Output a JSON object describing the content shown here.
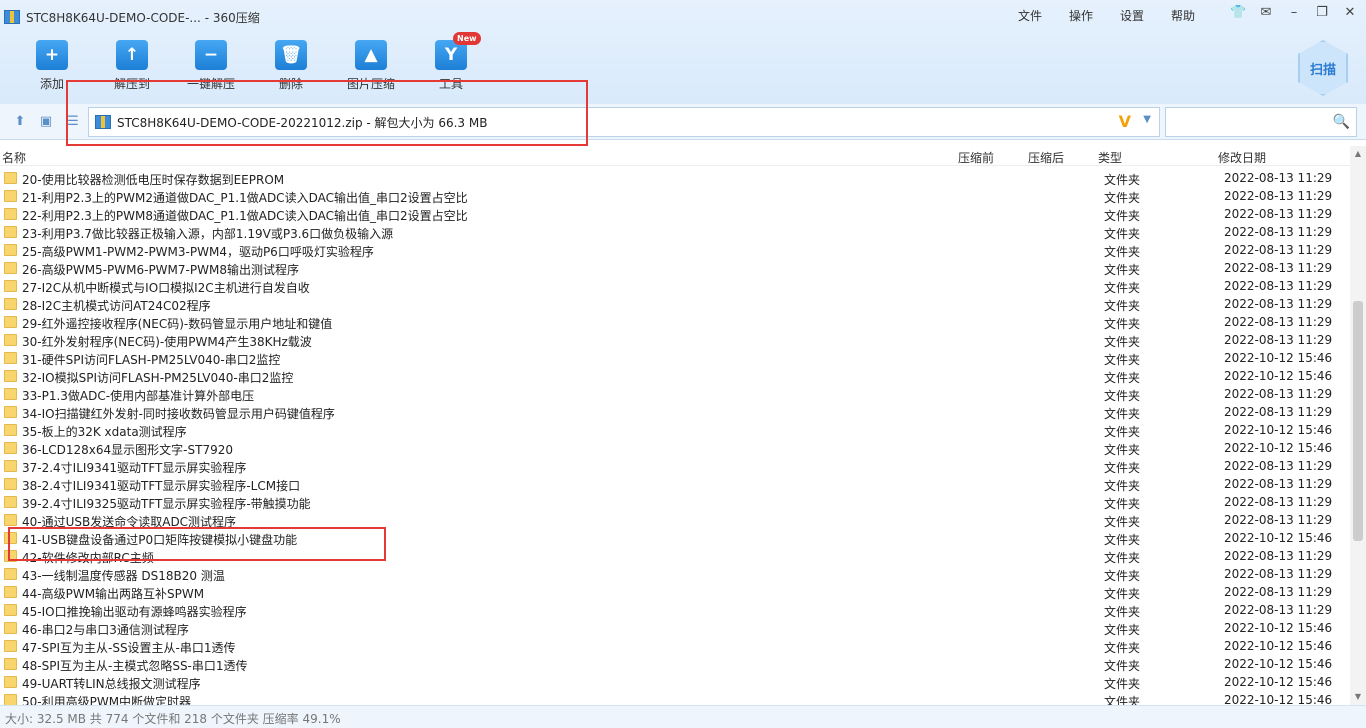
{
  "window": {
    "title": "STC8H8K64U-DEMO-CODE-... - 360压缩",
    "menu": [
      "文件",
      "操作",
      "设置",
      "帮助"
    ]
  },
  "toolbar": {
    "buttons": [
      {
        "label": "添加",
        "icon": "add-icon"
      },
      {
        "label": "解压到",
        "icon": "extract-to-icon"
      },
      {
        "label": "一键解压",
        "icon": "one-click-extract-icon"
      },
      {
        "label": "删除",
        "icon": "delete-icon"
      },
      {
        "label": "图片压缩",
        "icon": "image-compress-icon"
      },
      {
        "label": "工具",
        "icon": "tools-icon",
        "badge": "New"
      }
    ],
    "scan_label": "扫描"
  },
  "address": {
    "path": "STC8H8K64U-DEMO-CODE-20221012.zip - 解包大小为 66.3 MB"
  },
  "columns": {
    "name": "名称",
    "before": "压缩前",
    "after": "压缩后",
    "type": "类型",
    "modified": "修改日期"
  },
  "files": [
    {
      "name": "20-使用比较器检测低电压时保存数据到EEPROM",
      "type": "文件夹",
      "date": "2022-08-13 11:29"
    },
    {
      "name": "21-利用P2.3上的PWM2通道做DAC_P1.1做ADC读入DAC输出值_串口2设置占空比",
      "type": "文件夹",
      "date": "2022-08-13 11:29"
    },
    {
      "name": "22-利用P2.3上的PWM8通道做DAC_P1.1做ADC读入DAC输出值_串口2设置占空比",
      "type": "文件夹",
      "date": "2022-08-13 11:29"
    },
    {
      "name": "23-利用P3.7做比较器正极输入源，内部1.19V或P3.6口做负极输入源",
      "type": "文件夹",
      "date": "2022-08-13 11:29"
    },
    {
      "name": "25-高级PWM1-PWM2-PWM3-PWM4，驱动P6口呼吸灯实验程序",
      "type": "文件夹",
      "date": "2022-08-13 11:29"
    },
    {
      "name": "26-高级PWM5-PWM6-PWM7-PWM8输出测试程序",
      "type": "文件夹",
      "date": "2022-08-13 11:29"
    },
    {
      "name": "27-I2C从机中断模式与IO口模拟I2C主机进行自发自收",
      "type": "文件夹",
      "date": "2022-08-13 11:29"
    },
    {
      "name": "28-I2C主机模式访问AT24C02程序",
      "type": "文件夹",
      "date": "2022-08-13 11:29"
    },
    {
      "name": "29-红外遥控接收程序(NEC码)-数码管显示用户地址和键值",
      "type": "文件夹",
      "date": "2022-08-13 11:29"
    },
    {
      "name": "30-红外发射程序(NEC码)-使用PWM4产生38KHz载波",
      "type": "文件夹",
      "date": "2022-08-13 11:29"
    },
    {
      "name": "31-硬件SPI访问FLASH-PM25LV040-串口2监控",
      "type": "文件夹",
      "date": "2022-10-12 15:46"
    },
    {
      "name": "32-IO模拟SPI访问FLASH-PM25LV040-串口2监控",
      "type": "文件夹",
      "date": "2022-10-12 15:46"
    },
    {
      "name": "33-P1.3做ADC-使用内部基准计算外部电压",
      "type": "文件夹",
      "date": "2022-08-13 11:29"
    },
    {
      "name": "34-IO扫描键红外发射-同时接收数码管显示用户码键值程序",
      "type": "文件夹",
      "date": "2022-08-13 11:29"
    },
    {
      "name": "35-板上的32K xdata测试程序",
      "type": "文件夹",
      "date": "2022-10-12 15:46"
    },
    {
      "name": "36-LCD128x64显示图形文字-ST7920",
      "type": "文件夹",
      "date": "2022-10-12 15:46"
    },
    {
      "name": "37-2.4寸ILI9341驱动TFT显示屏实验程序",
      "type": "文件夹",
      "date": "2022-08-13 11:29"
    },
    {
      "name": "38-2.4寸ILI9341驱动TFT显示屏实验程序-LCM接口",
      "type": "文件夹",
      "date": "2022-08-13 11:29"
    },
    {
      "name": "39-2.4寸ILI9325驱动TFT显示屏实验程序-带触摸功能",
      "type": "文件夹",
      "date": "2022-08-13 11:29"
    },
    {
      "name": "40-通过USB发送命令读取ADC测试程序",
      "type": "文件夹",
      "date": "2022-08-13 11:29"
    },
    {
      "name": "41-USB键盘设备通过P0口矩阵按键模拟小键盘功能",
      "type": "文件夹",
      "date": "2022-10-12 15:46"
    },
    {
      "name": "42-软件修改内部RC主频",
      "type": "文件夹",
      "date": "2022-08-13 11:29"
    },
    {
      "name": "43-一线制温度传感器 DS18B20 测温",
      "type": "文件夹",
      "date": "2022-08-13 11:29"
    },
    {
      "name": "44-高级PWM输出两路互补SPWM",
      "type": "文件夹",
      "date": "2022-08-13 11:29"
    },
    {
      "name": "45-IO口推挽输出驱动有源蜂鸣器实验程序",
      "type": "文件夹",
      "date": "2022-08-13 11:29"
    },
    {
      "name": "46-串口2与串口3通信测试程序",
      "type": "文件夹",
      "date": "2022-10-12 15:46"
    },
    {
      "name": "47-SPI互为主从-SS设置主从-串口1透传",
      "type": "文件夹",
      "date": "2022-10-12 15:46"
    },
    {
      "name": "48-SPI互为主从-主模式忽略SS-串口1透传",
      "type": "文件夹",
      "date": "2022-10-12 15:46"
    },
    {
      "name": "49-UART转LIN总线报文测试程序",
      "type": "文件夹",
      "date": "2022-10-12 15:46"
    },
    {
      "name": "50-利用高级PWM中断做定时器",
      "type": "文件夹",
      "date": "2022-10-12 15:46"
    }
  ],
  "status": "大小: 32.5 MB 共 774 个文件和 218 个文件夹 压缩率 49.1%"
}
